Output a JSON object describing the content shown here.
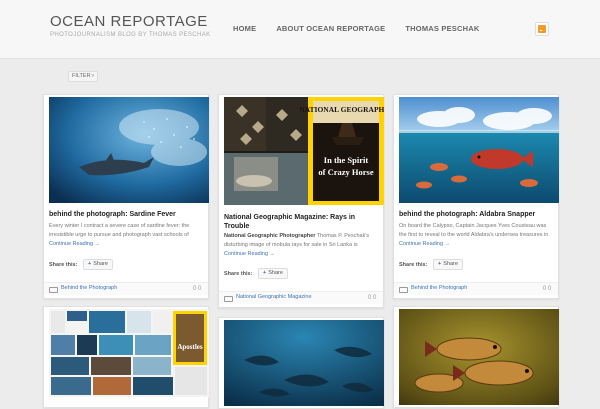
{
  "site": {
    "title": "OCEAN REPORTAGE",
    "description": "PHOTOJOURNALISM BLOG BY THOMAS PESCHAK"
  },
  "nav": {
    "items": [
      {
        "label": "HOME"
      },
      {
        "label": "ABOUT OCEAN REPORTAGE"
      },
      {
        "label": "THOMAS PESCHAK"
      }
    ]
  },
  "filter": {
    "label": "FILTER"
  },
  "posts": [
    {
      "title": "behind the photograph: Sardine Fever",
      "lead": "",
      "excerpt": "Every winter I contract a severe case of sardine fever: the irresistible urge to pursue and photograph vast schools of",
      "more": "Continue Reading →",
      "share_label": "Share this:",
      "share_button": "Share",
      "category": "Behind the Photograph",
      "comments": "0 0"
    },
    {
      "title": "National Geographic Magazine: Rays in Trouble",
      "lead": "National Geographic Photographer",
      "excerpt": "Thomas P. Peschak's disturbing image of mobula rays for sale in Sri Lanka is",
      "more": "Continue Reading →",
      "share_label": "Share this:",
      "share_button": "Share",
      "category": "National Geographic Magazine",
      "comments": "0 0",
      "magazine": {
        "brand": "NATIONAL GEOGRAPHIC",
        "cover_line_1": "In the Spirit",
        "cover_line_2": "of Crazy Horse"
      }
    },
    {
      "title": "behind the photograph: Aldabra Snapper",
      "lead": "",
      "excerpt": "On board the Calypso, Captain Jacques Yves Cousteau was the first to reveal to the world Aldabra's undersea treasures in",
      "more": "Continue Reading →",
      "share_label": "Share this:",
      "share_button": "Share",
      "category": "Behind the Photograph",
      "comments": "0 0"
    },
    {
      "title": "",
      "magazine": {
        "cover_line_1": "Apostles"
      }
    },
    {
      "title": ""
    },
    {
      "title": ""
    }
  ],
  "colors": {
    "accent": "#3b73b9",
    "rss": "#f39a2b",
    "background": "#ececec"
  }
}
